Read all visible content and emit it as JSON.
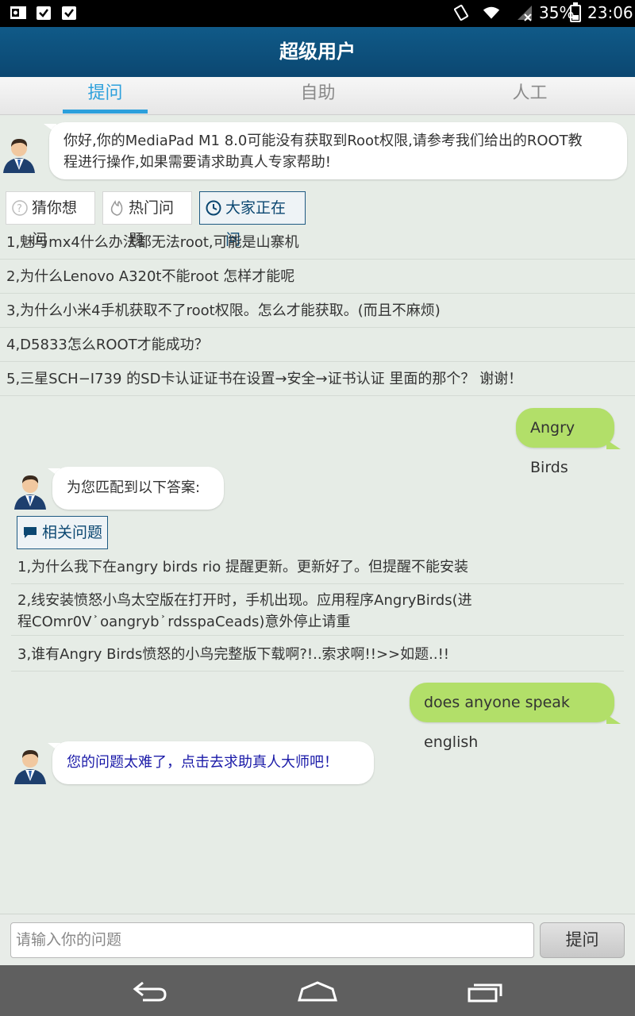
{
  "status_bar": {
    "battery": "35%",
    "time": "23:06"
  },
  "header": {
    "title": "超级用户"
  },
  "tabs": [
    {
      "label": "提问",
      "active": true
    },
    {
      "label": "自助",
      "active": false
    },
    {
      "label": "人工",
      "active": false
    }
  ],
  "welcome_message": {
    "line1": "你好,你的MediaPad M1 8.0可能没有获取到Root权限,请参考我们给出的ROOT教",
    "line2": "程进行操作,如果需要请求助真人专家帮助!"
  },
  "chips": [
    {
      "label": "猜你想问",
      "selected": false
    },
    {
      "label": "热门问题",
      "selected": false
    },
    {
      "label": "大家正在问",
      "selected": true
    }
  ],
  "questions": [
    "1,魅与mx4什么办法都无法root,可能是山寨机",
    "2,为什么Lenovo A320t不能root  怎样才能呢",
    "3,为什么小米4手机获取不了root权限。怎么才能获取。(而且不麻烦)",
    "4,D5833怎么ROOT才能成功？",
    "5,三星SCH−I739  的SD卡认证证书在设置→安全→证书认证   里面的那个？   谢谢！"
  ],
  "user_message_1": "Angry Birds",
  "answer_intro": "为您匹配到以下答案:",
  "related_label": "相关问题",
  "answers": [
    {
      "line1": "1,为什么我下在angry birds rio 提醒更新。更新好了。但提醒不能安装",
      "line2": ""
    },
    {
      "line1": "2,线安装愤怒小鸟太空版在打开时，手机出现。应用程序AngryBirds(进",
      "line2": "程COmr0V ͐ oangryb ͐ rdsspaCeads)意外停止请重"
    },
    {
      "line1": "3,谁有Angry Birds愤怒的小鸟完整版下载啊?!..索求啊!!>>如题..!!",
      "line2": ""
    }
  ],
  "user_message_2": "does anyone speak english",
  "bot_reply": "您的问题太难了，点击去求助真人大师吧！",
  "input": {
    "placeholder": "请输入你的问题"
  },
  "ask_button": "提问",
  "colors": {
    "accent": "#2ca0dc",
    "header": "#0b4771",
    "user_bubble": "#b2df69",
    "link_text": "#1a1aa8"
  }
}
